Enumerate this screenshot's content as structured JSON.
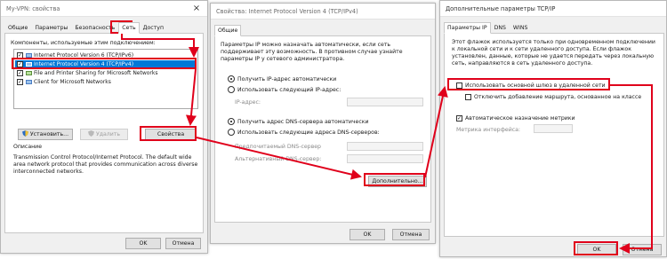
{
  "win1": {
    "title": "My-VPN: свойства",
    "tabs": [
      "Общие",
      "Параметры",
      "Безопасность",
      "Сеть",
      "Доступ"
    ],
    "components_label": "Компоненты, используемые этим подключением:",
    "items": [
      "Internet Protocol Version 6 (TCP/IPv6)",
      "Internet Protocol Version 4 (TCP/IPv4)",
      "File and Printer Sharing for Microsoft Networks",
      "Client for Microsoft Networks"
    ],
    "install_button": "Установить...",
    "remove_button": "Удалить",
    "properties_button": "Свойства",
    "description_title": "Описание",
    "description_text": "Transmission Control Protocol/Internet Protocol. The default wide area network protocol that provides communication across diverse interconnected networks.",
    "ok_button": "OK",
    "cancel_button": "Отмена"
  },
  "win2": {
    "title": "Свойства: Internet Protocol Version 4 (TCP/IPv4)",
    "tab": "Общие",
    "intro": "Параметры IP можно назначать автоматически, если сеть поддерживает эту возможность. В противном случае узнайте параметры IP у сетевого администратора.",
    "auto_ip": "Получить IP-адрес автоматически",
    "manual_ip": "Использовать следующий IP-адрес:",
    "ip_label": "IP-адрес:",
    "auto_dns": "Получить адрес DNS-сервера автоматически",
    "manual_dns": "Использовать следующие адреса DNS-серверов:",
    "preferred_dns": "Предпочитаемый DNS-сервер",
    "alternate_dns": "Альтернативный DNS-сервер:",
    "advanced_button": "Дополнительно...",
    "ok_button": "OK",
    "cancel_button": "Отмена"
  },
  "win3": {
    "title": "Дополнительные параметры TCP/IP",
    "tabs": [
      "Параметры IP",
      "DNS",
      "WINS"
    ],
    "info": "Этот флажок используется только при одновременном подключении к локальной сети и к сети удаленного доступа. Если флажок установлен, данные, которые не удается передать через локальную сеть, направляются в сеть удаленного доступа.",
    "use_gateway": "Использовать основной шлюз в удаленной сети",
    "disable_class_route": "Отключить добавление маршрута, основанное на классе",
    "auto_metric": "Автоматическое назначение метрики",
    "metric_label": "Метрика интерфейса:",
    "ok_button": "OK",
    "cancel_button": "Отмена"
  },
  "colors": {
    "highlight": "#e0001b",
    "selection": "#0078d7"
  }
}
